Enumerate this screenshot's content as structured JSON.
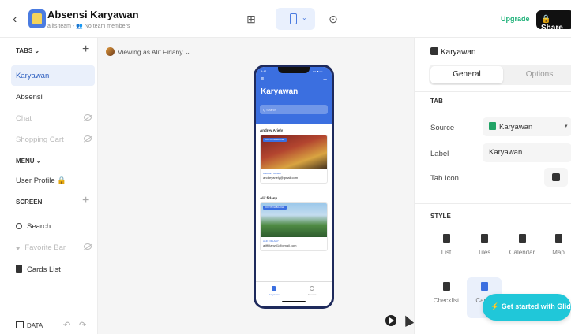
{
  "app": {
    "title": "Absensi Karyawan",
    "subtitle": "alifs team - 👥 No team members",
    "upgrade_label": "Upgrade",
    "share_label": "Share",
    "back_glyph": "‹",
    "table_glyph": "⊞",
    "settings_glyph": "⊙",
    "chevron_glyph": "⌄"
  },
  "sidebar": {
    "tabs_title": "TABS ⌄",
    "plus_glyph": "+",
    "tabs": [
      {
        "label": "Karyawan"
      },
      {
        "label": "Absensi"
      },
      {
        "label": "Chat"
      },
      {
        "label": "Shopping Cart"
      }
    ],
    "menu_title": "MENU ⌄",
    "menu_item": "User Profile 🔒",
    "screen_title": "SCREEN",
    "screen_items": [
      {
        "label": "Search"
      },
      {
        "label": "Favorite Bar"
      },
      {
        "label": "Cards List"
      }
    ],
    "heart_glyph": "♥",
    "data_label": "DATA",
    "undo_glyph": "↶",
    "redo_glyph": "↷"
  },
  "canvas": {
    "viewing_label": "Viewing as Alif Firlany ⌄"
  },
  "phone": {
    "time": "9:41",
    "status": "••• ▾ ▬",
    "menu_glyph": "≡",
    "plus_glyph": "+",
    "title": "Karyawan",
    "search_placeholder": "Q Search",
    "cards": [
      {
        "name": "Andrey Ariely",
        "badge": "CONTOH BADGE",
        "keyword": "ANDREY ARIELY",
        "email": "andreyariely@gmail.com"
      },
      {
        "name": "Alif firlany",
        "badge": "CONTOH BADGE",
        "keyword": "ALIF FIRLANY",
        "email": "aliffirlany01@gmail.com"
      }
    ],
    "tab_labels": [
      "Karyawan",
      "Absensi"
    ]
  },
  "right_panel": {
    "header": "Karyawan",
    "tabs": {
      "general": "General",
      "options": "Options"
    },
    "tab_section": "TAB",
    "source_label": "Source",
    "source_value": "Karyawan",
    "label_label": "Label",
    "label_value": "Karyawan",
    "tab_icon_label": "Tab Icon",
    "dropdown_glyph": "▾",
    "style_section": "STYLE",
    "styles_row1": [
      "List",
      "Tiles",
      "Calendar",
      "Map"
    ],
    "styles_row2": [
      "Checklist",
      "Cards"
    ],
    "cta_label": "⚡ Get started with Glide"
  },
  "colors": {
    "accent": "#3b6fe0",
    "upgrade": "#20b27a",
    "cta": "#20c7d9",
    "phone_frame": "#1e2a5c"
  }
}
